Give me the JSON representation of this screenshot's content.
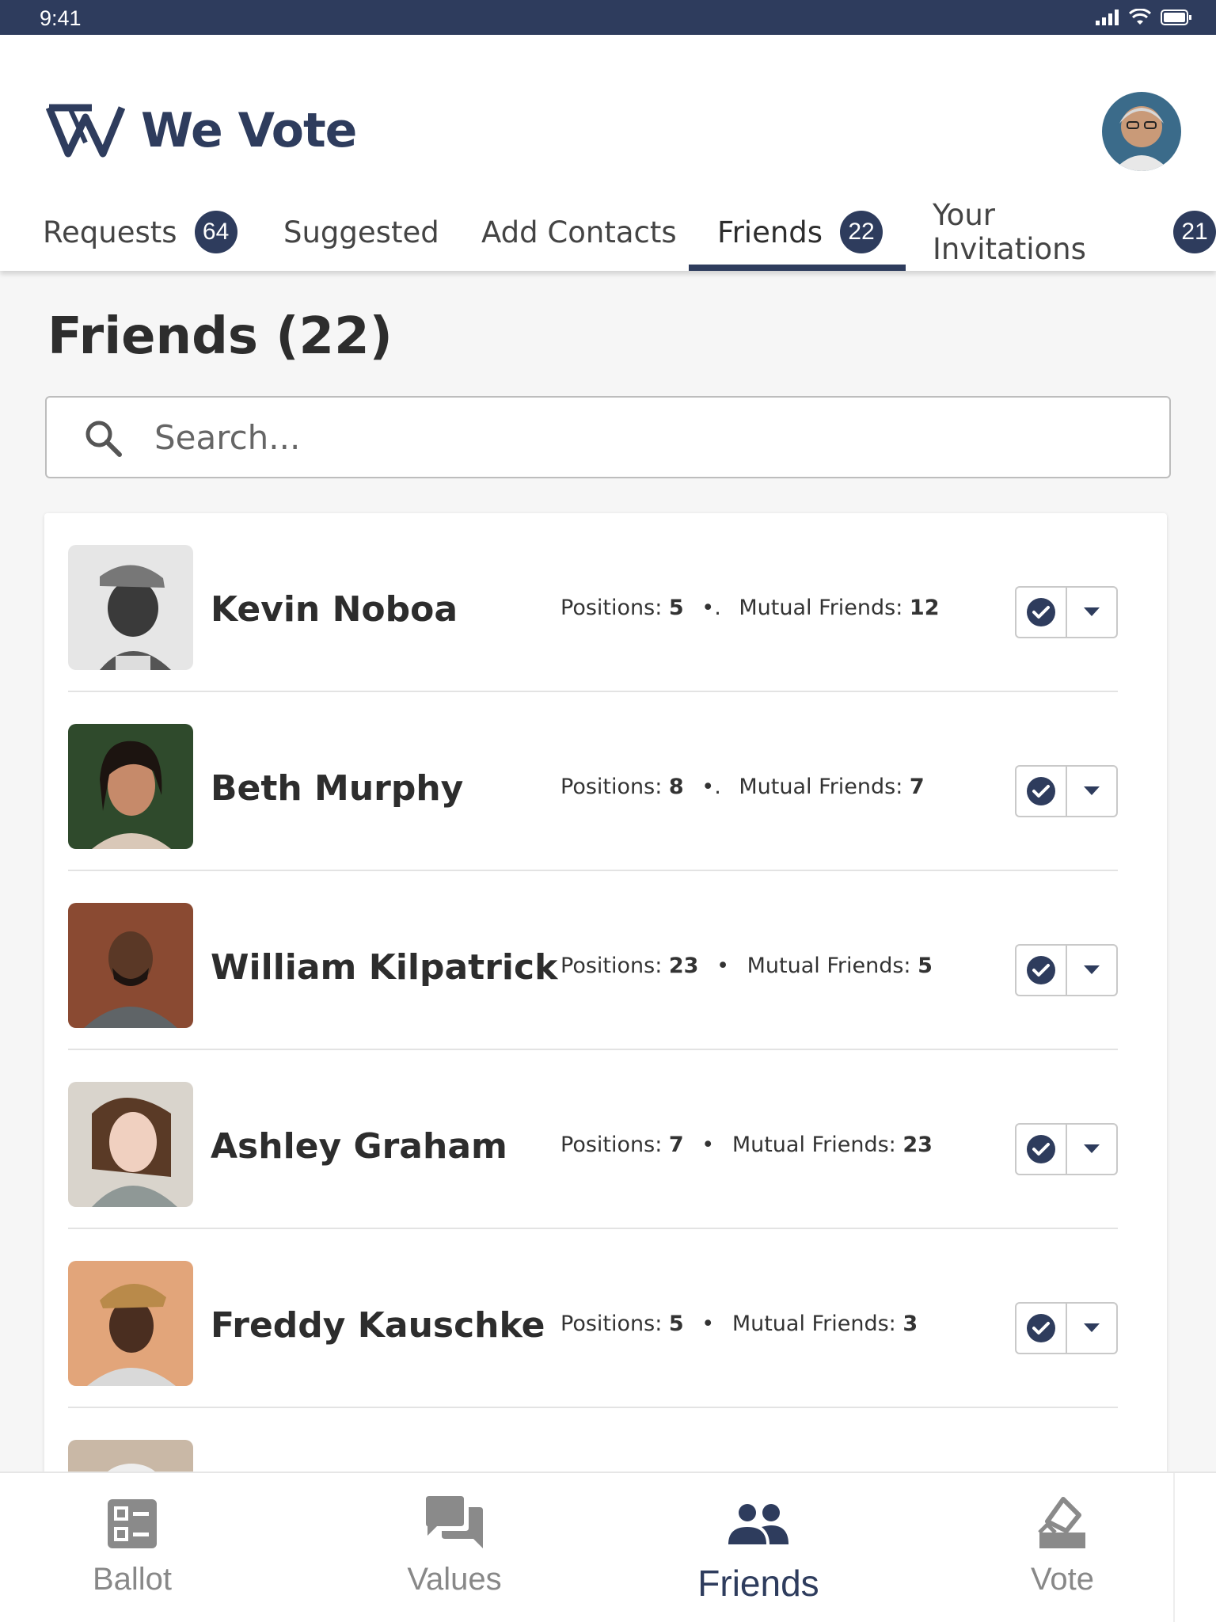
{
  "status_bar": {
    "time": "9:41"
  },
  "app": {
    "name": "We Vote"
  },
  "tabs": [
    {
      "label": "Requests",
      "badge": "64"
    },
    {
      "label": "Suggested",
      "badge": ""
    },
    {
      "label": "Add Contacts",
      "badge": ""
    },
    {
      "label": "Friends",
      "badge": "22"
    },
    {
      "label": "Your Invitations",
      "badge": "21"
    }
  ],
  "active_tab": "Friends",
  "page": {
    "title": "Friends (22)"
  },
  "search": {
    "placeholder": "Search..."
  },
  "friends": [
    {
      "name": "Kevin Noboa",
      "positions_label": "Positions:",
      "positions": "5",
      "separator": "•.",
      "mutual_label": "Mutual Friends:",
      "mutual": "12"
    },
    {
      "name": "Beth Murphy",
      "positions_label": "Positions:",
      "positions": "8",
      "separator": "•.",
      "mutual_label": "Mutual Friends:",
      "mutual": "7"
    },
    {
      "name": "William Kilpatrick",
      "positions_label": "Positions:",
      "positions": "23",
      "separator": "•",
      "mutual_label": "Mutual Friends:",
      "mutual": "5"
    },
    {
      "name": "Ashley Graham",
      "positions_label": "Positions:",
      "positions": "7",
      "separator": "•",
      "mutual_label": "Mutual Friends:",
      "mutual": "23"
    },
    {
      "name": "Freddy Kauschke",
      "positions_label": "Positions:",
      "positions": "5",
      "separator": "•",
      "mutual_label": "Mutual Friends:",
      "mutual": "3"
    }
  ],
  "bottom_nav": [
    {
      "label": "Ballot",
      "icon": "ballot-icon"
    },
    {
      "label": "Values",
      "icon": "values-icon"
    },
    {
      "label": "Friends",
      "icon": "friends-icon"
    },
    {
      "label": "Vote",
      "icon": "vote-icon"
    }
  ],
  "colors": {
    "brand": "#2e3c5d",
    "background": "#f6f6f6",
    "muted": "#888888"
  }
}
